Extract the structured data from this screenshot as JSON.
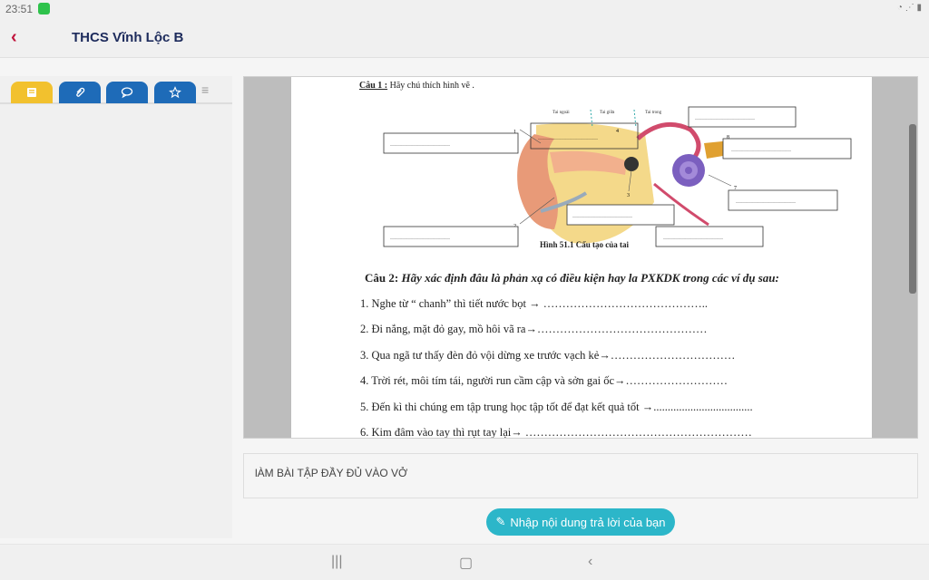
{
  "status": {
    "time": "23:51"
  },
  "header": {
    "title": "THCS Vĩnh Lộc B"
  },
  "document": {
    "q1_label": "Câu 1 :",
    "q1_text": "Hãy chú thích hình vẽ .",
    "diagram": {
      "labels": [
        "Tai ngoài",
        "Tai giữa",
        "Tai trong"
      ],
      "numbers": [
        "1",
        "2",
        "3",
        "4",
        "5",
        "6",
        "7",
        "8"
      ],
      "blank": "……………………………"
    },
    "caption": "Hình 51.1 Cấu tạo của tai",
    "q2_label": "Câu 2:",
    "q2_text": "Hãy xác định đâu là phản xạ có điều kiện hay la PXKDK trong các ví dụ sau:",
    "items": [
      "1. Nghe từ “  chanh” thì tiết nước bọt → ……………………………………..",
      "2. Đi nắng, mặt đỏ gay, mồ hôi vã ra→………………………………………",
      "3. Qua ngã tư thấy đèn đỏ vội dừng xe trước vạch kẻ→……………………………",
      "4. Trời rét, môi tím tái, người run cầm cập và sởn gai ốc→………………………",
      "5. Đến kì thi chúng em tập trung học tập tốt để đạt kết quả tốt →...................................",
      "6. Kim đâm vào tay thì rụt tay lại→ ……………………………………………………"
    ]
  },
  "note": "lÀM BÀI TẬP ĐẦY ĐỦ VÀO VỞ",
  "answer_button": "Nhập nội dung trả lời của bạn"
}
